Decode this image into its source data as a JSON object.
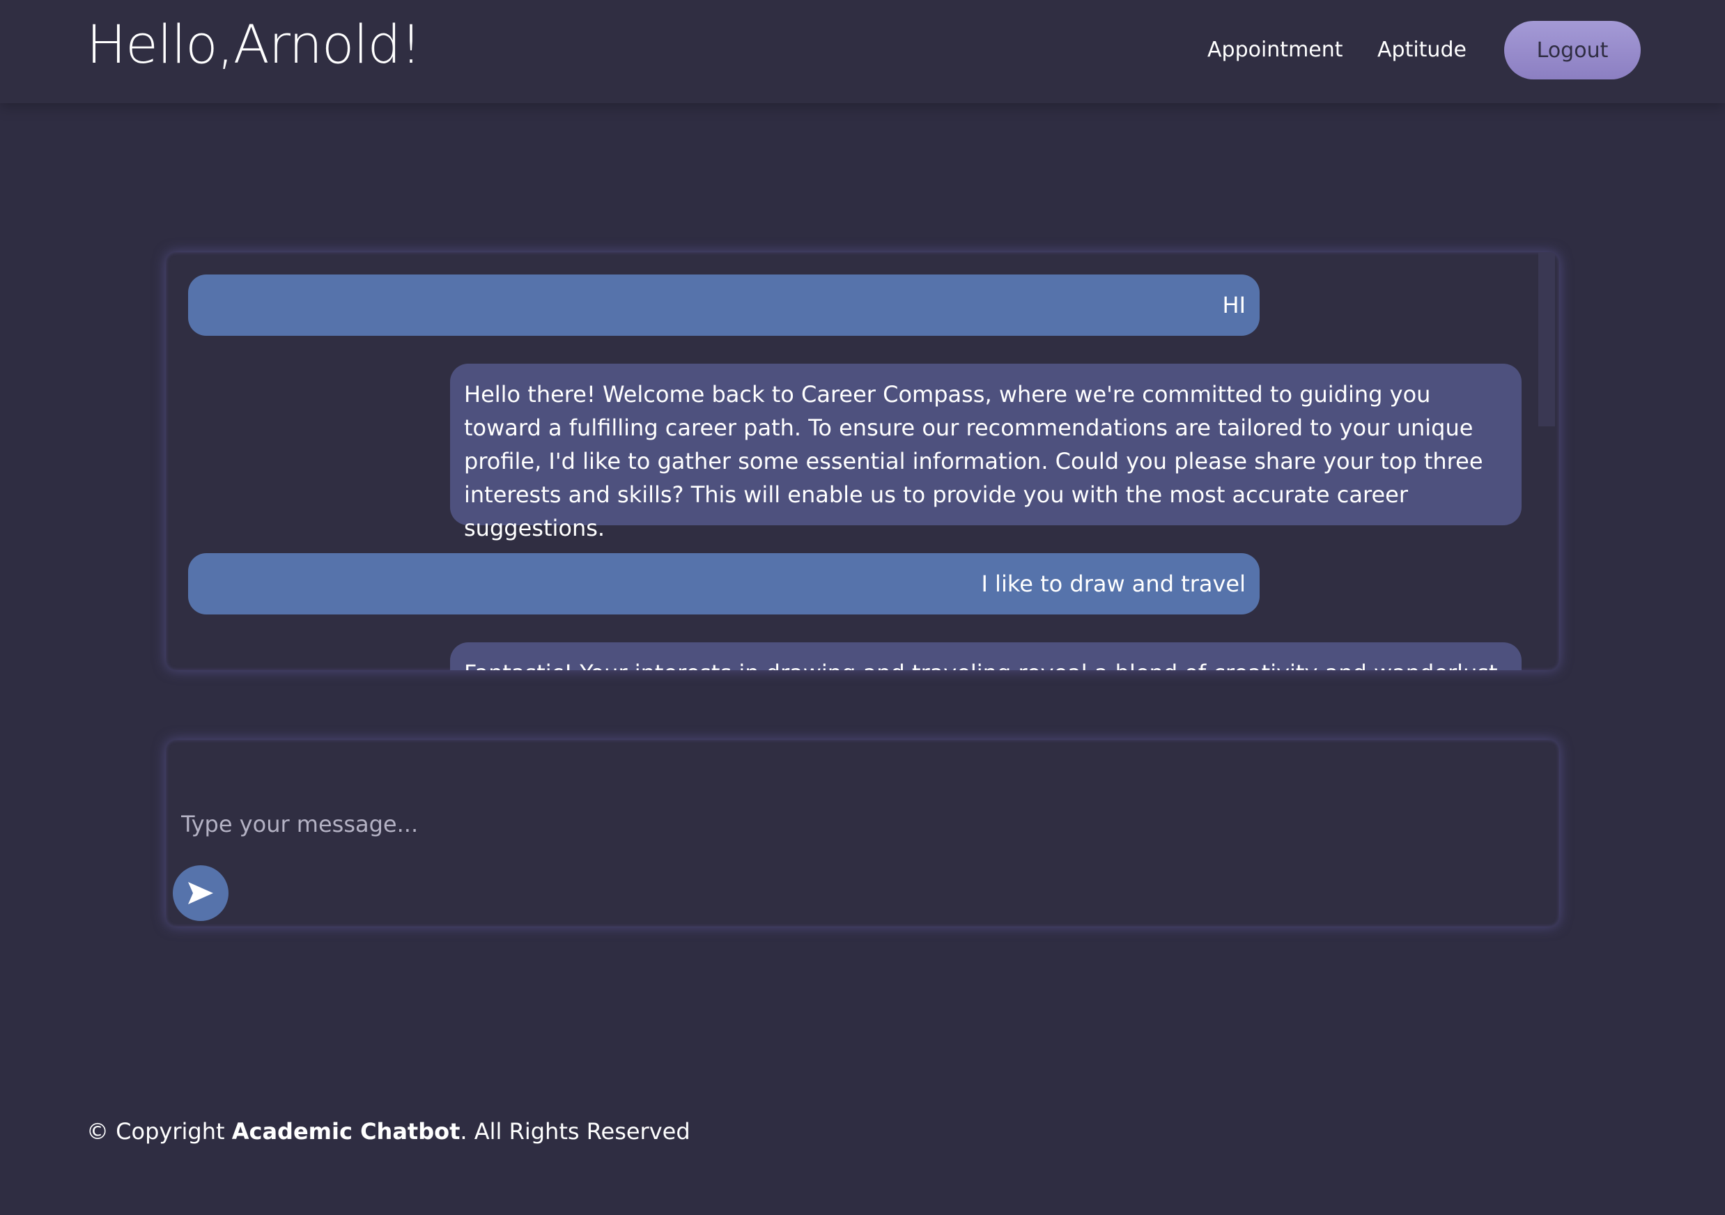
{
  "header": {
    "greeting": "Hello,Arnold!",
    "nav": {
      "appointment": "Appointment",
      "aptitude": "Aptitude"
    },
    "logout_label": "Logout"
  },
  "chat": {
    "messages": [
      {
        "role": "user",
        "text": "HI"
      },
      {
        "role": "bot",
        "text": "Hello there! Welcome back to Career Compass, where we're committed to guiding you toward a fulfilling career path. To ensure our recommendations are tailored to your unique profile, I'd like to gather some essential information. Could you please share your top three interests and skills? This will enable us to provide you with the most accurate career suggestions."
      },
      {
        "role": "user",
        "text": "I like to draw and travel"
      },
      {
        "role": "bot",
        "text": "Fantastic! Your interests in drawing and traveling reveal a blend of creativity and wanderlust. These"
      }
    ]
  },
  "composer": {
    "placeholder": "Type your message...",
    "send_icon": "send-arrow-icon"
  },
  "footer": {
    "prefix": "© Copyright ",
    "brand": "Academic Chatbot",
    "suffix": ". All Rights Reserved"
  },
  "colors": {
    "background": "#2f2d42",
    "user_bubble": "#5673ab",
    "bot_bubble": "#4e517e",
    "logout_button": "#9a8fcf"
  }
}
